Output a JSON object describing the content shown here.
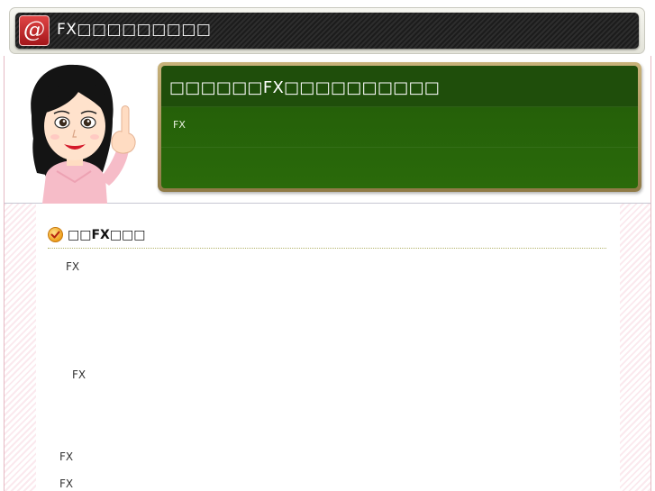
{
  "header": {
    "logo_glyph": "@",
    "site_title": "FX□□□□□□□□□"
  },
  "hero": {
    "board_title": "□□□□□□FX□□□□□□□□□□",
    "board_text": "FX"
  },
  "main": {
    "section_title": "□□FX□□□",
    "paragraphs": [
      "FX",
      "FX",
      "FX",
      "FX"
    ]
  },
  "colors": {
    "board_green": "#1f4e0b",
    "board_frame": "#b49b62",
    "header_dark": "#222222",
    "logo_red": "#c0282c",
    "side_stripe_pink": "#fbe9ee"
  }
}
